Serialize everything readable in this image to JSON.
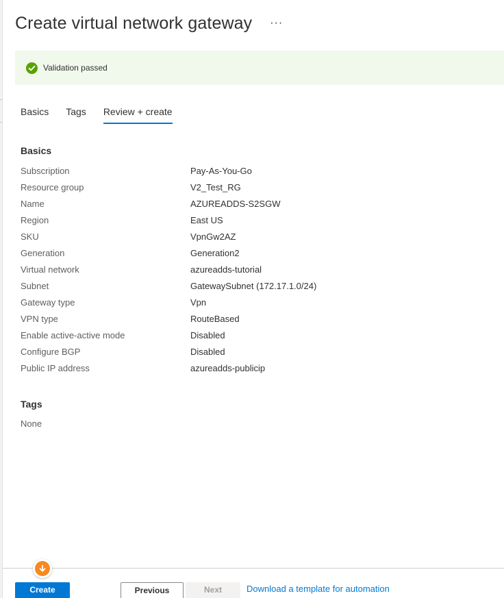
{
  "page": {
    "title": "Create virtual network gateway",
    "more_label": "···"
  },
  "banner": {
    "status_icon": "checkmark-circle-icon",
    "status_color": "#57a300",
    "background": "#f1f8ec",
    "text": "Validation passed"
  },
  "tabs": [
    {
      "label": "Basics",
      "active": false
    },
    {
      "label": "Tags",
      "active": false
    },
    {
      "label": "Review + create",
      "active": true
    }
  ],
  "basics": {
    "heading": "Basics",
    "rows": [
      {
        "label": "Subscription",
        "value": "Pay-As-You-Go"
      },
      {
        "label": "Resource group",
        "value": "V2_Test_RG"
      },
      {
        "label": "Name",
        "value": "AZUREADDS-S2SGW"
      },
      {
        "label": "Region",
        "value": "East US"
      },
      {
        "label": "SKU",
        "value": "VpnGw2AZ"
      },
      {
        "label": "Generation",
        "value": "Generation2"
      },
      {
        "label": "Virtual network",
        "value": "azureadds-tutorial"
      },
      {
        "label": "Subnet",
        "value": "GatewaySubnet (172.17.1.0/24)"
      },
      {
        "label": "Gateway type",
        "value": "Vpn"
      },
      {
        "label": "VPN type",
        "value": "RouteBased"
      },
      {
        "label": "Enable active-active mode",
        "value": "Disabled"
      },
      {
        "label": "Configure BGP",
        "value": "Disabled"
      },
      {
        "label": "Public IP address",
        "value": "azureadds-publicip"
      }
    ]
  },
  "tags": {
    "heading": "Tags",
    "value": "None"
  },
  "footer": {
    "create_label": "Create",
    "create_color": "#0078d4",
    "badge_icon": "download-arrow-icon",
    "badge_color": "#f7891f",
    "previous_label": "Previous",
    "next_label": "Next",
    "download_link": "Download a template for automation"
  }
}
